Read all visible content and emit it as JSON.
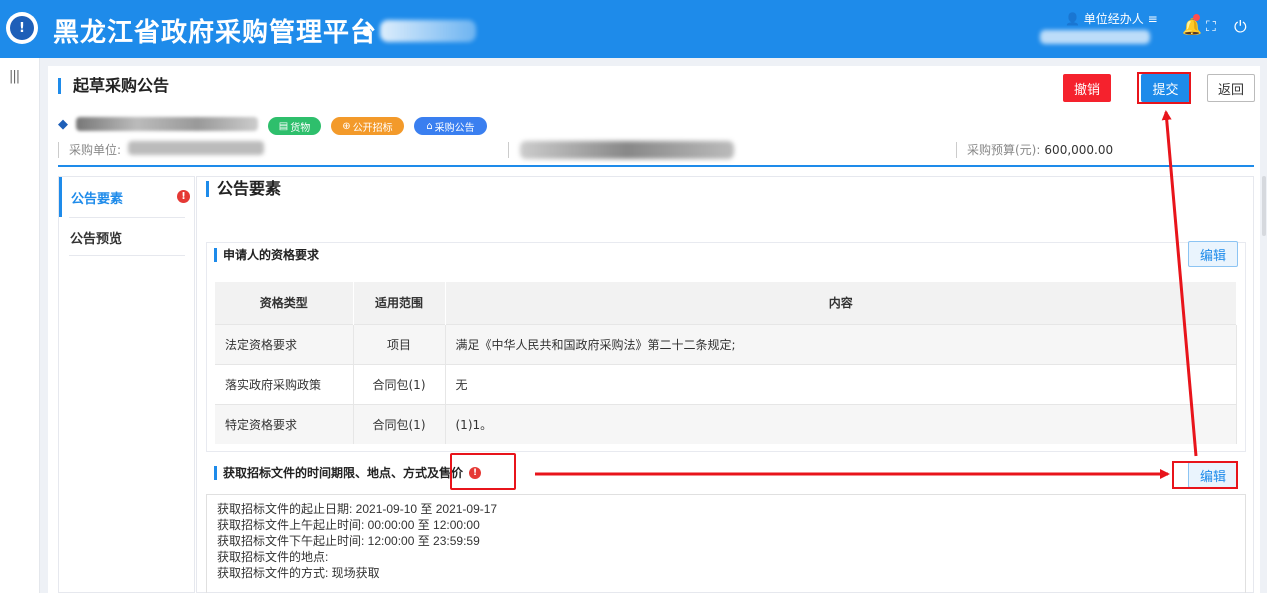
{
  "header": {
    "app_title": "黑龙江省政府采购管理平台",
    "user_label": "单位经办人"
  },
  "page": {
    "title": "起草采购公告",
    "buttons": {
      "cancel": "撤销",
      "submit": "提交",
      "back": "返回"
    },
    "tags": [
      "货物",
      "公开招标",
      "采购公告"
    ],
    "meta": {
      "unit_label": "采购单位:",
      "budget_label": "采购预算(元):",
      "budget_value": "600,000.00"
    }
  },
  "subnav": {
    "items": [
      "公告要素",
      "公告预览"
    ]
  },
  "content": {
    "section_title": "公告要素",
    "qualification": {
      "title": "申请人的资格要求",
      "edit_label": "编辑",
      "headers": [
        "资格类型",
        "适用范围",
        "内容"
      ],
      "rows": [
        {
          "type": "法定资格要求",
          "scope": "项目",
          "content": "满足《中华人民共和国政府采购法》第二十二条规定;"
        },
        {
          "type": "落实政府采购政策",
          "scope": "合同包(1)",
          "content": "无"
        },
        {
          "type": "特定资格要求",
          "scope": "合同包(1)",
          "content": "(1)1。"
        }
      ]
    },
    "doc_fetch": {
      "title": "获取招标文件的时间期限、地点、方式及售价",
      "edit_label": "编辑",
      "lines": [
        "获取招标文件的起止日期: 2021-09-10 至 2021-09-17",
        "获取招标文件上午起止时间: 00:00:00 至 12:00:00",
        "获取招标文件下午起止时间: 12:00:00 至 23:59:59",
        "获取招标文件的地点:",
        "获取招标文件的方式: 现场获取"
      ]
    }
  },
  "colors": {
    "primary": "#1e8bea",
    "danger": "#f5222d",
    "annotation": "#e8141b"
  }
}
